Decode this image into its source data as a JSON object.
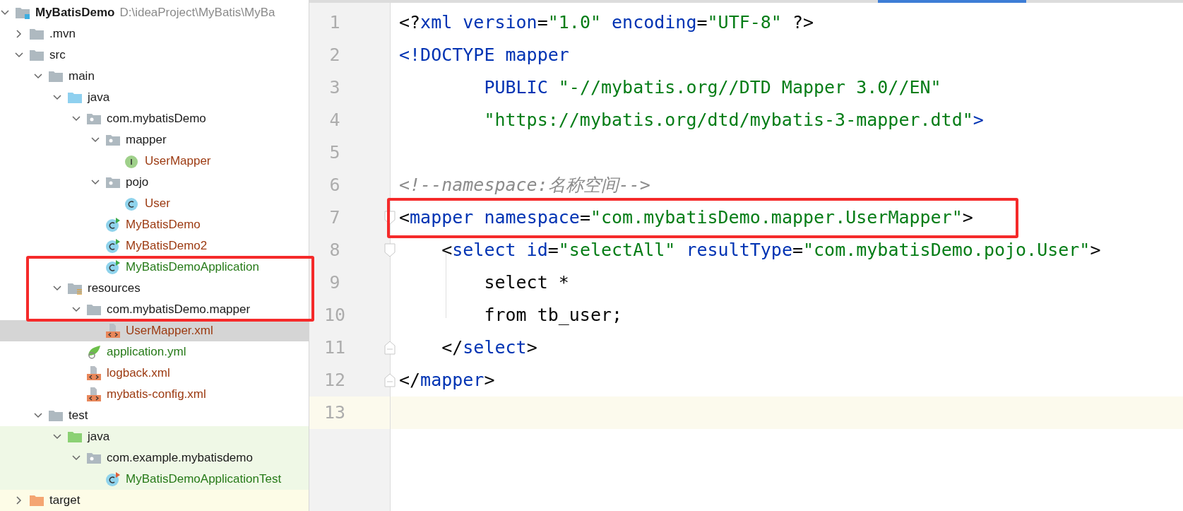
{
  "project_tree": [
    {
      "label": "MyBatisDemo",
      "path": "D:\\ideaProject\\MyBatis\\MyBa",
      "kind": "module",
      "expanded": true,
      "selected": false,
      "children": [
        {
          "label": ".mvn",
          "kind": "folder",
          "expanded": false,
          "selected": false
        },
        {
          "label": "src",
          "kind": "folder",
          "expanded": true,
          "selected": false,
          "children": [
            {
              "label": "main",
              "kind": "folder",
              "expanded": true,
              "selected": false,
              "children": [
                {
                  "label": "java",
                  "kind": "source-folder",
                  "expanded": true,
                  "selected": false,
                  "children": [
                    {
                      "label": "com.mybatisDemo",
                      "kind": "package",
                      "expanded": true,
                      "selected": false,
                      "children": [
                        {
                          "label": "mapper",
                          "kind": "package",
                          "expanded": true,
                          "selected": false,
                          "children": [
                            {
                              "label": "UserMapper",
                              "kind": "interface",
                              "selected": false,
                              "color": "#9c3a11"
                            }
                          ]
                        },
                        {
                          "label": "pojo",
                          "kind": "package",
                          "expanded": true,
                          "selected": false,
                          "children": [
                            {
                              "label": "User",
                              "kind": "class",
                              "selected": false,
                              "color": "#9c3a11"
                            }
                          ]
                        },
                        {
                          "label": "MyBatisDemo",
                          "kind": "run-class",
                          "selected": false,
                          "color": "#9c3a11"
                        },
                        {
                          "label": "MyBatisDemo2",
                          "kind": "run-class",
                          "selected": false,
                          "color": "#9c3a11"
                        },
                        {
                          "label": "MyBatisDemoApplication",
                          "kind": "spring-class",
                          "selected": false,
                          "color": "#267a18"
                        }
                      ]
                    }
                  ]
                },
                {
                  "label": "resources",
                  "kind": "resource-folder",
                  "expanded": true,
                  "selected": false,
                  "children": [
                    {
                      "label": "com.mybatisDemo.mapper",
                      "kind": "folder",
                      "expanded": true,
                      "selected": false,
                      "children": [
                        {
                          "label": "UserMapper.xml",
                          "kind": "xml",
                          "selected": true,
                          "color": "#9c3a11"
                        }
                      ]
                    },
                    {
                      "label": "application.yml",
                      "kind": "yml",
                      "selected": false,
                      "color": "#267a18"
                    },
                    {
                      "label": "logback.xml",
                      "kind": "xml",
                      "selected": false,
                      "color": "#9c3a11"
                    },
                    {
                      "label": "mybatis-config.xml",
                      "kind": "xml",
                      "selected": false,
                      "color": "#9c3a11"
                    }
                  ]
                }
              ]
            },
            {
              "label": "test",
              "kind": "folder",
              "expanded": true,
              "selected": false,
              "children": [
                {
                  "label": "java",
                  "kind": "test-folder",
                  "expanded": true,
                  "selected": false,
                  "background": {
                    "color": "#eff8e6"
                  },
                  "children": [
                    {
                      "label": "com.example.mybatisdemo",
                      "kind": "package",
                      "expanded": true,
                      "selected": false,
                      "background": {
                        "color": "#eff8e6"
                      },
                      "children": [
                        {
                          "label": "MyBatisDemoApplicationTest",
                          "kind": "test-class",
                          "selected": false,
                          "background": {
                            "color": "#eff8e6"
                          },
                          "color": "#267a18"
                        }
                      ]
                    }
                  ]
                }
              ]
            }
          ]
        },
        {
          "label": "target",
          "kind": "excluded-folder",
          "expanded": false,
          "selected": false,
          "background": {
            "color": "#fdfce7"
          }
        }
      ]
    }
  ],
  "editor": {
    "lines": [
      {
        "number": "1",
        "kind": "plain",
        "annotated": false,
        "segments": [
          {
            "text": "<?",
            "kind": "punct"
          },
          {
            "text": "xml version",
            "kind": "tag"
          },
          {
            "text": "=",
            "kind": "punct"
          },
          {
            "text": "\"1.0\"",
            "kind": "value"
          },
          {
            "text": " encoding",
            "kind": "tag"
          },
          {
            "text": "=",
            "kind": "punct"
          },
          {
            "text": "\"UTF-8\"",
            "kind": "value"
          },
          {
            "text": " ?>",
            "kind": "punct"
          }
        ]
      },
      {
        "number": "2",
        "kind": "plain",
        "annotated": false,
        "segments": [
          {
            "text": "<!DOCTYPE mapper",
            "kind": "tag"
          }
        ]
      },
      {
        "number": "3",
        "kind": "plain",
        "annotated": false,
        "segments": [
          {
            "text": "        PUBLIC ",
            "kind": "tag"
          },
          {
            "text": "\"-//mybatis.org//DTD Mapper 3.0//EN\"",
            "kind": "value"
          }
        ]
      },
      {
        "number": "4",
        "kind": "plain",
        "annotated": false,
        "segments": [
          {
            "text": "        \"https://mybatis.org/dtd/mybatis-3-mapper.dtd\"",
            "kind": "value"
          },
          {
            "text": ">",
            "kind": "tag"
          }
        ]
      },
      {
        "number": "5",
        "kind": "plain",
        "annotated": false
      },
      {
        "number": "6",
        "kind": "plain",
        "annotated": false,
        "segments": [
          {
            "text": "<!--namespace:名称空间-->",
            "kind": "comment"
          }
        ]
      },
      {
        "number": "7",
        "kind": "fold-start",
        "annotated": true,
        "segments": [
          {
            "text": "<",
            "kind": "punct"
          },
          {
            "text": "mapper namespace",
            "kind": "tag"
          },
          {
            "text": "=",
            "kind": "punct"
          },
          {
            "text": "\"com.mybatisDemo.mapper.UserMapper\"",
            "kind": "value"
          },
          {
            "text": ">",
            "kind": "punct"
          }
        ]
      },
      {
        "number": "8",
        "kind": "fold-start",
        "annotated": false,
        "segments": [
          {
            "text": "    <",
            "kind": "punct"
          },
          {
            "text": "select id",
            "kind": "tag"
          },
          {
            "text": "=",
            "kind": "punct"
          },
          {
            "text": "\"selectAll\"",
            "kind": "value"
          },
          {
            "text": " resultType",
            "kind": "tag"
          },
          {
            "text": "=",
            "kind": "punct"
          },
          {
            "text": "\"com.mybatisDemo.pojo.User\"",
            "kind": "value"
          },
          {
            "text": ">",
            "kind": "punct"
          }
        ]
      },
      {
        "number": "9",
        "kind": "plain",
        "annotated": false,
        "segments": [
          {
            "text": "        select *",
            "kind": "punct"
          }
        ]
      },
      {
        "number": "10",
        "kind": "plain",
        "annotated": false,
        "segments": [
          {
            "text": "        from tb_user;",
            "kind": "punct"
          }
        ]
      },
      {
        "number": "11",
        "kind": "fold-end",
        "annotated": false,
        "segments": [
          {
            "text": "    </",
            "kind": "punct"
          },
          {
            "text": "select",
            "kind": "tag"
          },
          {
            "text": ">",
            "kind": "punct"
          }
        ]
      },
      {
        "number": "12",
        "kind": "fold-end",
        "annotated": false,
        "segments": [
          {
            "text": "</",
            "kind": "punct"
          },
          {
            "text": "mapper",
            "kind": "tag"
          },
          {
            "text": ">",
            "kind": "punct"
          }
        ]
      },
      {
        "number": "13",
        "kind": "plain",
        "annotated": false,
        "current": true
      }
    ]
  }
}
